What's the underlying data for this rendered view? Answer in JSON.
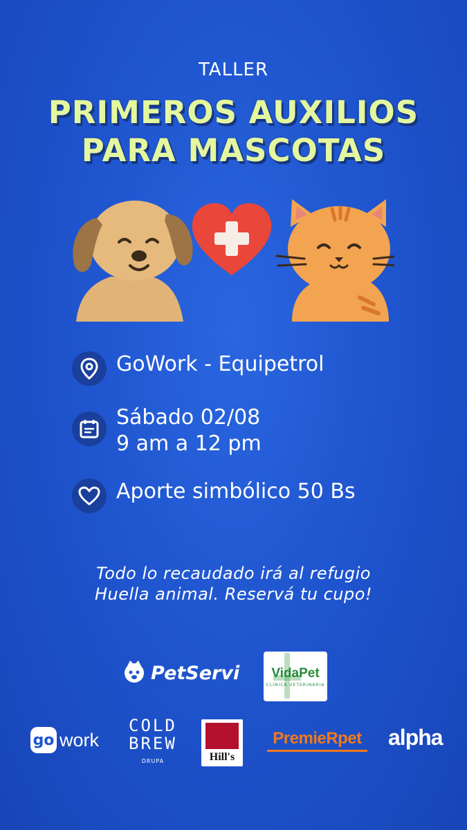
{
  "header": {
    "eyebrow": "TALLER",
    "title_line1": "PRIMEROS AUXILIOS",
    "title_line2": "PARA MASCOTAS"
  },
  "colors": {
    "background": "#1f55cf",
    "title": "#e4f79f",
    "heart": "#e8473a",
    "dog": "#e6b97c",
    "cat": "#f3a450"
  },
  "illustration": {
    "icons": [
      "dog-icon",
      "heart-cross-icon",
      "cat-icon"
    ]
  },
  "info": {
    "location": "GoWork - Equipetrol",
    "date": "Sábado 02/08",
    "time": "9 am a 12 pm",
    "price": "Aporte simbólico 50 Bs",
    "icons": [
      "location-pin-icon",
      "calendar-icon",
      "heart-icon"
    ]
  },
  "note": {
    "line1": "Todo lo recaudado irá al refugio",
    "line2": "Huella animal. Reservá tu cupo!"
  },
  "sponsors": {
    "petservi": "PetServi",
    "vidapet_name": "VidaPet",
    "vidapet_sub": "CLÍNICA VETERINARIA",
    "gowork_go": "go",
    "gowork_work": "work",
    "coldbrew_line1": "COLD",
    "coldbrew_line2": "BREW",
    "coldbrew_sub": "DRUPA",
    "hills": "Hill's",
    "premier": "PremieRpet",
    "alpha": "alpha"
  }
}
